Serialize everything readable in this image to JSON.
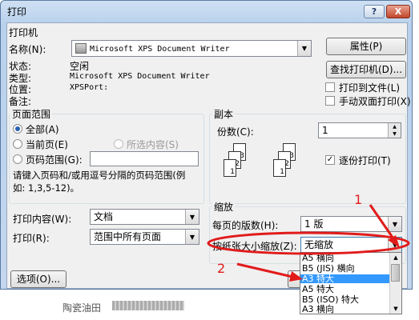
{
  "dialog": {
    "title": "打印",
    "help_label": "?",
    "close_label": "X"
  },
  "printer": {
    "group_title": "打印机",
    "name_label": "名称(N):",
    "name_value": "Microsoft XPS Document Writer",
    "properties_label": "属性(P)",
    "find_label": "查找打印机(D)...",
    "status_label": "状态:",
    "status_value": "空闲",
    "type_label": "类型:",
    "type_value": "Microsoft XPS Document Writer",
    "where_label": "位置:",
    "where_value": "XPSPort:",
    "comment_label": "备注:",
    "print_to_file_label": "打印到文件(L)",
    "duplex_label": "手动双面打印(X)"
  },
  "page_range": {
    "group_title": "页面范围",
    "all_label": "全部(A)",
    "current_label": "当前页(E)",
    "selection_label": "所选内容(S)",
    "pages_label": "页码范围(G):",
    "hint_line1": "请键入页码和/或用逗号分隔的页码范围(例",
    "hint_line2": "如: 1,3,5-12)。"
  },
  "copies": {
    "group_title": "副本",
    "count_label": "份数(C):",
    "count_value": "1",
    "collate_label": "逐份打印(T)",
    "page_labels": [
      "3",
      "2",
      "1",
      "3",
      "2",
      "1"
    ]
  },
  "print_what": {
    "label": "打印内容(W):",
    "value": "文档"
  },
  "print_range": {
    "label": "打印(R):",
    "value": "范围中所有页面"
  },
  "zoom": {
    "group_title": "缩放",
    "pages_per_sheet_label": "每页的版数(H):",
    "pages_per_sheet_value": "1 版",
    "scale_label": "按纸张大小缩放(Z):",
    "scale_value": "无缩放",
    "options": [
      "A5 横向",
      "B5 (JIS) 横向",
      "A3 特大",
      "A5 特大",
      "B5 (ISO) 特大",
      "A3 横向"
    ],
    "selected_option": "A3 特大"
  },
  "options_button": "选项(O)...",
  "annotations": {
    "marker1": "1",
    "marker2": "2",
    "accent": "#e11b1b"
  },
  "background_doc_line": "陶瓷油田"
}
